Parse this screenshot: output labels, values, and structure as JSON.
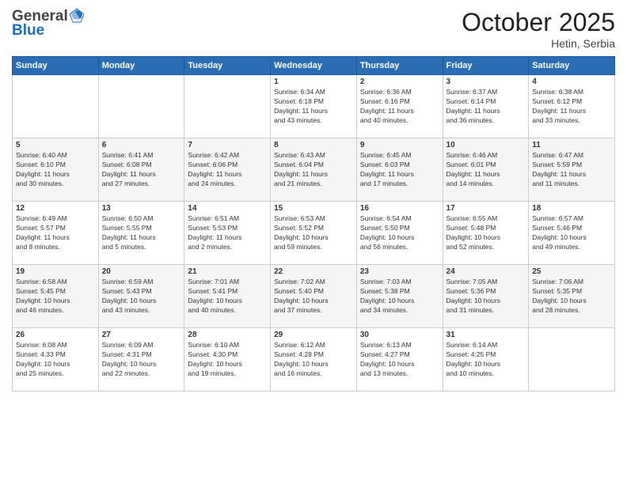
{
  "header": {
    "logo_line1": "General",
    "logo_line2": "Blue",
    "month": "October 2025",
    "location": "Hetin, Serbia"
  },
  "weekdays": [
    "Sunday",
    "Monday",
    "Tuesday",
    "Wednesday",
    "Thursday",
    "Friday",
    "Saturday"
  ],
  "weeks": [
    [
      {
        "day": "",
        "content": ""
      },
      {
        "day": "",
        "content": ""
      },
      {
        "day": "",
        "content": ""
      },
      {
        "day": "1",
        "content": "Sunrise: 6:34 AM\nSunset: 6:18 PM\nDaylight: 11 hours\nand 43 minutes."
      },
      {
        "day": "2",
        "content": "Sunrise: 6:36 AM\nSunset: 6:16 PM\nDaylight: 11 hours\nand 40 minutes."
      },
      {
        "day": "3",
        "content": "Sunrise: 6:37 AM\nSunset: 6:14 PM\nDaylight: 11 hours\nand 36 minutes."
      },
      {
        "day": "4",
        "content": "Sunrise: 6:38 AM\nSunset: 6:12 PM\nDaylight: 11 hours\nand 33 minutes."
      }
    ],
    [
      {
        "day": "5",
        "content": "Sunrise: 6:40 AM\nSunset: 6:10 PM\nDaylight: 11 hours\nand 30 minutes."
      },
      {
        "day": "6",
        "content": "Sunrise: 6:41 AM\nSunset: 6:08 PM\nDaylight: 11 hours\nand 27 minutes."
      },
      {
        "day": "7",
        "content": "Sunrise: 6:42 AM\nSunset: 6:06 PM\nDaylight: 11 hours\nand 24 minutes."
      },
      {
        "day": "8",
        "content": "Sunrise: 6:43 AM\nSunset: 6:04 PM\nDaylight: 11 hours\nand 21 minutes."
      },
      {
        "day": "9",
        "content": "Sunrise: 6:45 AM\nSunset: 6:03 PM\nDaylight: 11 hours\nand 17 minutes."
      },
      {
        "day": "10",
        "content": "Sunrise: 6:46 AM\nSunset: 6:01 PM\nDaylight: 11 hours\nand 14 minutes."
      },
      {
        "day": "11",
        "content": "Sunrise: 6:47 AM\nSunset: 5:59 PM\nDaylight: 11 hours\nand 11 minutes."
      }
    ],
    [
      {
        "day": "12",
        "content": "Sunrise: 6:49 AM\nSunset: 5:57 PM\nDaylight: 11 hours\nand 8 minutes."
      },
      {
        "day": "13",
        "content": "Sunrise: 6:50 AM\nSunset: 5:55 PM\nDaylight: 11 hours\nand 5 minutes."
      },
      {
        "day": "14",
        "content": "Sunrise: 6:51 AM\nSunset: 5:53 PM\nDaylight: 11 hours\nand 2 minutes."
      },
      {
        "day": "15",
        "content": "Sunrise: 6:53 AM\nSunset: 5:52 PM\nDaylight: 10 hours\nand 59 minutes."
      },
      {
        "day": "16",
        "content": "Sunrise: 6:54 AM\nSunset: 5:50 PM\nDaylight: 10 hours\nand 56 minutes."
      },
      {
        "day": "17",
        "content": "Sunrise: 6:55 AM\nSunset: 5:48 PM\nDaylight: 10 hours\nand 52 minutes."
      },
      {
        "day": "18",
        "content": "Sunrise: 6:57 AM\nSunset: 5:46 PM\nDaylight: 10 hours\nand 49 minutes."
      }
    ],
    [
      {
        "day": "19",
        "content": "Sunrise: 6:58 AM\nSunset: 5:45 PM\nDaylight: 10 hours\nand 46 minutes."
      },
      {
        "day": "20",
        "content": "Sunrise: 6:59 AM\nSunset: 5:43 PM\nDaylight: 10 hours\nand 43 minutes."
      },
      {
        "day": "21",
        "content": "Sunrise: 7:01 AM\nSunset: 5:41 PM\nDaylight: 10 hours\nand 40 minutes."
      },
      {
        "day": "22",
        "content": "Sunrise: 7:02 AM\nSunset: 5:40 PM\nDaylight: 10 hours\nand 37 minutes."
      },
      {
        "day": "23",
        "content": "Sunrise: 7:03 AM\nSunset: 5:38 PM\nDaylight: 10 hours\nand 34 minutes."
      },
      {
        "day": "24",
        "content": "Sunrise: 7:05 AM\nSunset: 5:36 PM\nDaylight: 10 hours\nand 31 minutes."
      },
      {
        "day": "25",
        "content": "Sunrise: 7:06 AM\nSunset: 5:35 PM\nDaylight: 10 hours\nand 28 minutes."
      }
    ],
    [
      {
        "day": "26",
        "content": "Sunrise: 6:08 AM\nSunset: 4:33 PM\nDaylight: 10 hours\nand 25 minutes."
      },
      {
        "day": "27",
        "content": "Sunrise: 6:09 AM\nSunset: 4:31 PM\nDaylight: 10 hours\nand 22 minutes."
      },
      {
        "day": "28",
        "content": "Sunrise: 6:10 AM\nSunset: 4:30 PM\nDaylight: 10 hours\nand 19 minutes."
      },
      {
        "day": "29",
        "content": "Sunrise: 6:12 AM\nSunset: 4:28 PM\nDaylight: 10 hours\nand 16 minutes."
      },
      {
        "day": "30",
        "content": "Sunrise: 6:13 AM\nSunset: 4:27 PM\nDaylight: 10 hours\nand 13 minutes."
      },
      {
        "day": "31",
        "content": "Sunrise: 6:14 AM\nSunset: 4:25 PM\nDaylight: 10 hours\nand 10 minutes."
      },
      {
        "day": "",
        "content": ""
      }
    ]
  ]
}
